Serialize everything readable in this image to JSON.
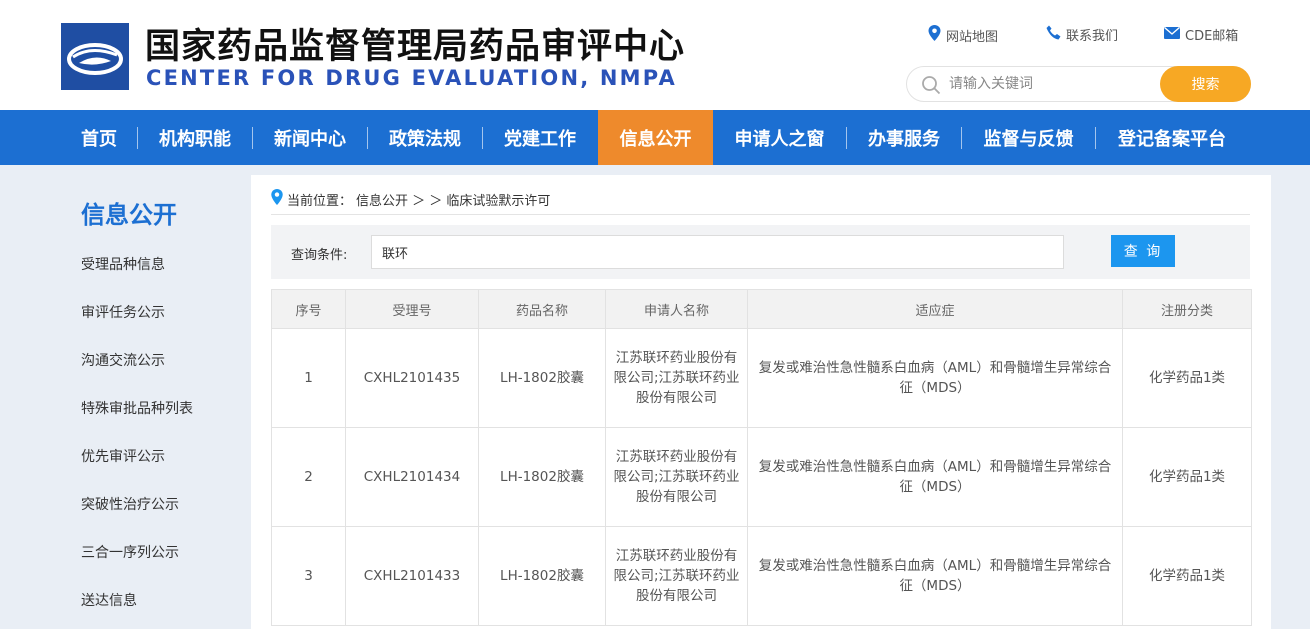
{
  "header": {
    "title_cn": "国家药品监督管理局药品审评中心",
    "title_en": "CENTER FOR DRUG EVALUATION, NMPA",
    "links": [
      {
        "label": "网站地图",
        "icon": "map-pin-icon"
      },
      {
        "label": "联系我们",
        "icon": "phone-icon"
      },
      {
        "label": "CDE邮箱",
        "icon": "mail-icon"
      }
    ],
    "search": {
      "placeholder": "请输入关键词",
      "button": "搜索"
    }
  },
  "nav": {
    "items": [
      "首页",
      "机构职能",
      "新闻中心",
      "政策法规",
      "党建工作",
      "信息公开",
      "申请人之窗",
      "办事服务",
      "监督与反馈",
      "登记备案平台"
    ],
    "active": "信息公开"
  },
  "sidebar": {
    "title": "信息公开",
    "items": [
      "受理品种信息",
      "审评任务公示",
      "沟通交流公示",
      "特殊审批品种列表",
      "优先审评公示",
      "突破性治疗公示",
      "三合一序列公示",
      "送达信息"
    ]
  },
  "breadcrumb": {
    "prefix": "当前位置：",
    "path": "信息公开 ＞ ＞ 临床试验默示许可"
  },
  "query": {
    "label": "查询条件:",
    "value": "联环",
    "button": "查 询"
  },
  "table": {
    "headers": [
      "序号",
      "受理号",
      "药品名称",
      "申请人名称",
      "适应症",
      "注册分类"
    ],
    "rows": [
      [
        "1",
        "CXHL2101435",
        "LH-1802胶囊",
        "江苏联环药业股份有限公司;江苏联环药业股份有限公司",
        "复发或难治性急性髓系白血病（AML）和骨髓增生异常综合征（MDS）",
        "化学药品1类"
      ],
      [
        "2",
        "CXHL2101434",
        "LH-1802胶囊",
        "江苏联环药业股份有限公司;江苏联环药业股份有限公司",
        "复发或难治性急性髓系白血病（AML）和骨髓增生异常综合征（MDS）",
        "化学药品1类"
      ],
      [
        "3",
        "CXHL2101433",
        "LH-1802胶囊",
        "江苏联环药业股份有限公司;江苏联环药业股份有限公司",
        "复发或难治性急性髓系白血病（AML）和骨髓增生异常综合征（MDS）",
        "化学药品1类"
      ]
    ]
  },
  "colors": {
    "nav_bg": "#1c6fd2",
    "nav_active": "#ee8a2c",
    "search_button": "#f7a824",
    "query_button": "#1c96ef",
    "logo_bg": "#1f4ea3"
  }
}
